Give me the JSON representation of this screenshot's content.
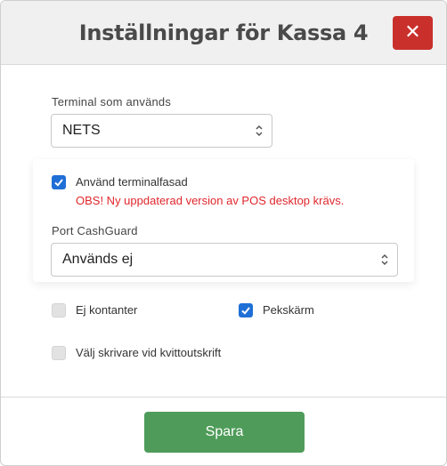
{
  "dialog": {
    "title": "Inställningar för Kassa 4",
    "close_icon": "times-icon",
    "close_color": "#c9302c"
  },
  "terminal": {
    "label": "Terminal som används",
    "selected": "NETS"
  },
  "terminal_facade": {
    "label": "Använd terminalfasad",
    "checked": true,
    "warning": "OBS! Ny uppdaterad version av POS desktop krävs.",
    "warning_color": "#e0272c"
  },
  "cashguard": {
    "label": "Port CashGuard",
    "selected": "Används ej"
  },
  "options": {
    "no_cash": {
      "label": "Ej kontanter",
      "checked": false
    },
    "touchscreen": {
      "label": "Pekskärm",
      "checked": true
    },
    "choose_printer": {
      "label": "Välj skrivare vid kvittoutskrift",
      "checked": false
    }
  },
  "footer": {
    "save_label": "Spara",
    "save_color": "#4f9c5a"
  },
  "accent": "#1f6fd6"
}
